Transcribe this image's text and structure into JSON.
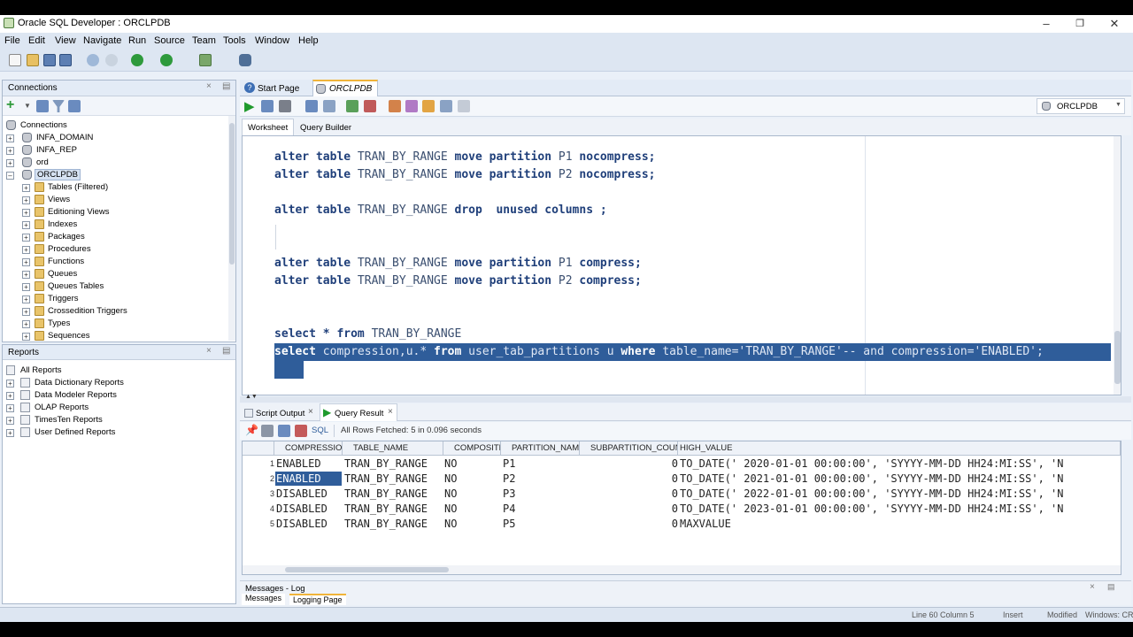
{
  "window": {
    "title": "Oracle SQL Developer : ORCLPDB"
  },
  "menu": [
    "File",
    "Edit",
    "View",
    "Navigate",
    "Run",
    "Source",
    "Team",
    "Tools",
    "Window",
    "Help"
  ],
  "connections_panel": {
    "title": "Connections",
    "root": "Connections",
    "connections": [
      "INFA_DOMAIN",
      "INFA_REP",
      "ord",
      "ORCLPDB"
    ],
    "children": [
      "Tables (Filtered)",
      "Views",
      "Editioning Views",
      "Indexes",
      "Packages",
      "Procedures",
      "Functions",
      "Queues",
      "Queues Tables",
      "Triggers",
      "Crossedition Triggers",
      "Types",
      "Sequences"
    ]
  },
  "reports_panel": {
    "title": "Reports",
    "items": [
      "All Reports",
      "Data Dictionary Reports",
      "Data Modeler Reports",
      "OLAP Reports",
      "TimesTen Reports",
      "User Defined Reports"
    ]
  },
  "editor_tabs": [
    "Start Page",
    "ORCLPDB"
  ],
  "connection_selector": "ORCLPDB",
  "worksheet_tabs": [
    "Worksheet",
    "Query Builder"
  ],
  "code": {
    "l1": {
      "a": "alter table ",
      "b": "TRAN_BY_RANGE",
      "c": " move partition ",
      "d": "P1",
      "e": " nocompress;"
    },
    "l2": {
      "a": "alter table ",
      "b": "TRAN_BY_RANGE",
      "c": " move partition ",
      "d": "P2",
      "e": " nocompress;"
    },
    "l3": {
      "a": "alter table ",
      "b": "TRAN_BY_RANGE",
      "c": " drop  unused columns ;"
    },
    "l4": {
      "a": "alter table ",
      "b": "TRAN_BY_RANGE",
      "c": " move partition ",
      "d": "P1",
      "e": " compress;"
    },
    "l5": {
      "a": "alter table ",
      "b": "TRAN_BY_RANGE",
      "c": " move partition ",
      "d": "P2",
      "e": " compress;"
    },
    "l6": {
      "a": "select * from ",
      "b": "TRAN_BY_RANGE"
    },
    "l7": {
      "a": "select",
      "b": " compression,u.* ",
      "c": "from",
      "d": " user_tab_partitions u ",
      "e": "where",
      "f": " table_name='TRAN_BY_RANGE'-- and compression='ENABLED';"
    }
  },
  "output_tabs": [
    "Script Output",
    "Query Result"
  ],
  "result_toolbar": {
    "sql_label": "SQL",
    "status": "All Rows Fetched: 5 in 0.096 seconds"
  },
  "result": {
    "columns": [
      "COMPRESSION",
      "TABLE_NAME",
      "COMPOSITE",
      "PARTITION_NAME",
      "SUBPARTITION_COUNT",
      "HIGH_VALUE"
    ],
    "rows": [
      [
        "1",
        "ENABLED",
        "TRAN_BY_RANGE",
        "NO",
        "P1",
        "0",
        "TO_DATE(' 2020-01-01 00:00:00', 'SYYYY-MM-DD HH24:MI:SS', 'N"
      ],
      [
        "2",
        "ENABLED",
        "TRAN_BY_RANGE",
        "NO",
        "P2",
        "0",
        "TO_DATE(' 2021-01-01 00:00:00', 'SYYYY-MM-DD HH24:MI:SS', 'N"
      ],
      [
        "3",
        "DISABLED",
        "TRAN_BY_RANGE",
        "NO",
        "P3",
        "0",
        "TO_DATE(' 2022-01-01 00:00:00', 'SYYYY-MM-DD HH24:MI:SS', 'N"
      ],
      [
        "4",
        "DISABLED",
        "TRAN_BY_RANGE",
        "NO",
        "P4",
        "0",
        "TO_DATE(' 2023-01-01 00:00:00', 'SYYYY-MM-DD HH24:MI:SS', 'N"
      ],
      [
        "5",
        "DISABLED",
        "TRAN_BY_RANGE",
        "NO",
        "P5",
        "0",
        "MAXVALUE"
      ]
    ]
  },
  "messages_panel": {
    "title": "Messages - Log",
    "tabs": [
      "Messages",
      "Logging Page"
    ]
  },
  "status": {
    "line": "Line 60 Column 5",
    "mode": "Insert",
    "modified": "Modified",
    "os": "Windows: CR"
  },
  "colors": {
    "selection": "#2f5d9a",
    "keyword": "#1f3f7a",
    "panel_bg": "#eaf0f8"
  }
}
